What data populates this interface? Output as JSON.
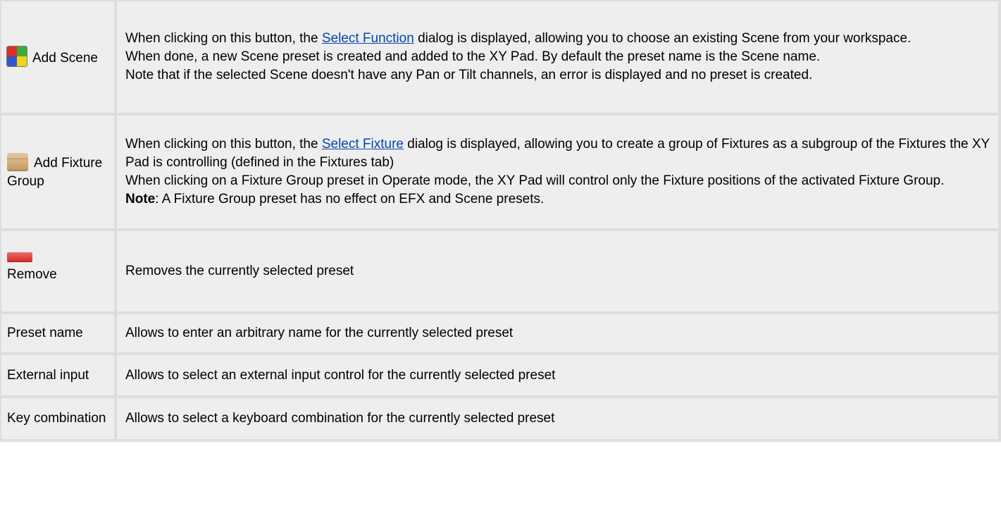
{
  "rows": [
    {
      "label": "Add Scene",
      "icon": "scene-icon",
      "desc_before_link": "When clicking on this button, the ",
      "link_text": "Select Function",
      "desc_after_link": " dialog is displayed, allowing you to choose an existing Scene from your workspace.",
      "desc_line2": "When done, a new Scene preset is created and added to the XY Pad. By default the preset name is the Scene name.",
      "desc_line3": "Note that if the selected Scene doesn't have any Pan or Tilt channels, an error is displayed and no preset is created."
    },
    {
      "label": "Add Fixture Group",
      "icon": "box-icon",
      "desc_before_link": "When clicking on this button, the ",
      "link_text": "Select Fixture",
      "desc_after_link": " dialog is displayed, allowing you to create a group of Fixtures as a subgroup of the Fixtures the XY Pad is controlling (defined in the Fixtures tab)",
      "desc_line2": "When clicking on a Fixture Group preset in Operate mode, the XY Pad will control only the Fixture positions of the activated Fixture Group.",
      "note_bold": "Note",
      "note_rest": ": A Fixture Group preset has no effect on EFX and Scene presets."
    },
    {
      "label": "Remove",
      "icon": "remove-icon",
      "desc": "Removes the currently selected preset"
    },
    {
      "label": "Preset name",
      "desc": "Allows to enter an arbitrary name for the currently selected preset"
    },
    {
      "label": "External input",
      "desc": "Allows to select an external input control for the currently selected preset"
    },
    {
      "label": "Key combination",
      "desc": "Allows to select a keyboard combination for the currently selected preset"
    }
  ],
  "colors": {
    "cell_bg": "#eeeeee",
    "border": "#dddddd",
    "link": "#0645ad"
  }
}
